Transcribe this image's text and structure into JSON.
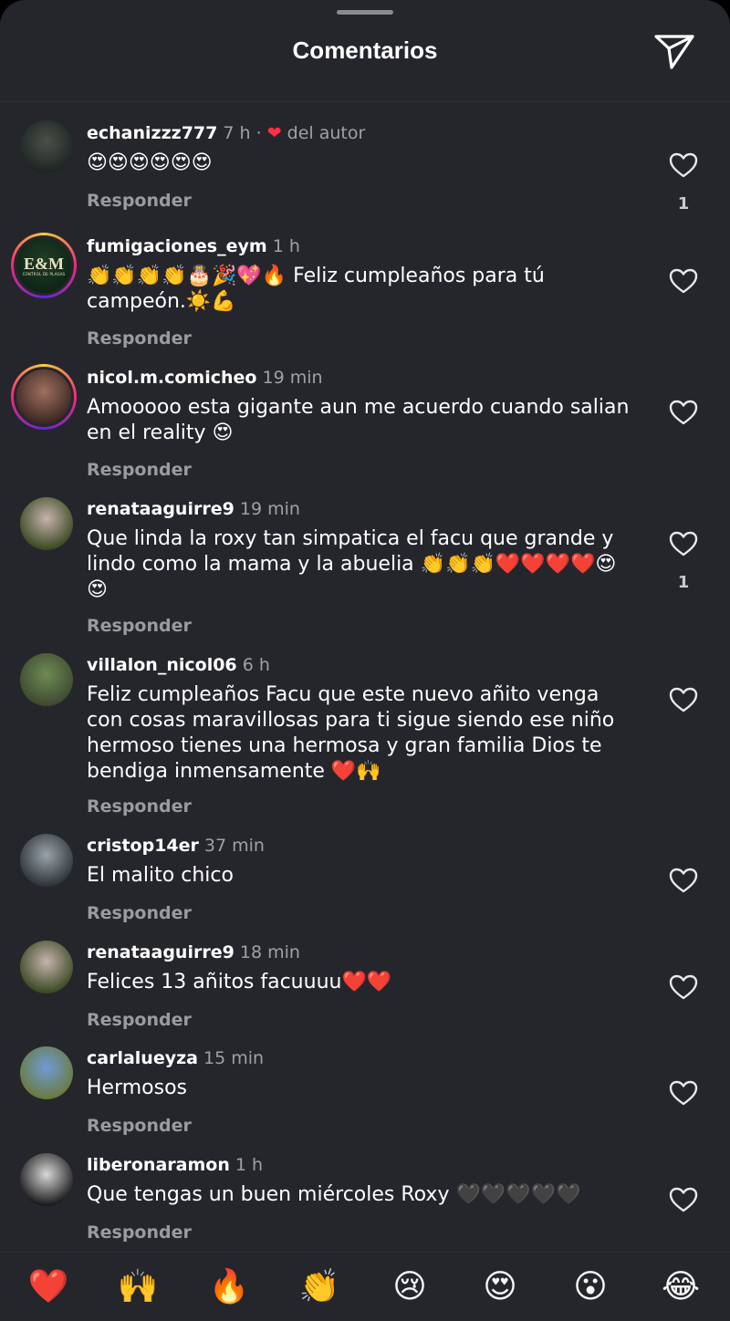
{
  "header": {
    "title": "Comentarios"
  },
  "comments": [
    {
      "user": "echanizzz777",
      "time": "7 h",
      "sep": "·",
      "heart_glyph": "❤",
      "by_author": "del autor",
      "text": "😍😍😍😍😍😍",
      "reply": "Responder",
      "likes": "1",
      "ring": false,
      "avatar_colors": [
        "#4a5148",
        "#1e2422"
      ]
    },
    {
      "user": "fumigaciones_eym",
      "time": "1 h",
      "text": "👏👏👏👏🎂🎉💖🔥 Feliz cumpleaños para tú campeón.☀️💪",
      "reply": "Responder",
      "ring": true,
      "avatar_logo": "E&M",
      "avatar_sub": "CONTROL DE PLAGAS",
      "avatar_colors": [
        "#1e3d26",
        "#0f2416"
      ]
    },
    {
      "user": "nicol.m.comicheo",
      "time": "19 min",
      "text": "Amooooo esta gigante aun me acuerdo cuando salian en el reality 😍",
      "reply": "Responder",
      "ring": true,
      "avatar_colors": [
        "#a07060",
        "#3b2722"
      ]
    },
    {
      "user": "renataaguirre9",
      "time": "19 min",
      "text": "Que linda la roxy tan simpatica el facu que grande y lindo como la mama y la abuelia 👏👏👏❤️❤️❤️❤️😍😍",
      "reply": "Responder",
      "likes": "1",
      "ring": false,
      "avatar_colors": [
        "#c7b2ae",
        "#3a4a22"
      ]
    },
    {
      "user": "villalon_nicol06",
      "time": "6 h",
      "text": "Feliz cumpleaños Facu que este nuevo añito venga con cosas maravillosas para ti sigue siendo ese niño hermoso tienes una hermosa y gran familia Dios te bendiga inmensamente ❤️🙌",
      "reply": "Responder",
      "ring": false,
      "avatar_colors": [
        "#6f8a55",
        "#3d4a30"
      ]
    },
    {
      "user": "cristop14er",
      "time": "37 min",
      "text": "El malito chico",
      "reply": "Responder",
      "ring": false,
      "avatar_colors": [
        "#9aa3aa",
        "#2e3438"
      ]
    },
    {
      "user": "renataaguirre9",
      "time": "18 min",
      "text": "Felices 13 añitos facuuuu❤️❤️",
      "reply": "Responder",
      "ring": false,
      "avatar_colors": [
        "#c7b2ae",
        "#3a4a22"
      ]
    },
    {
      "user": "carlalueyza",
      "time": "15 min",
      "text": "Hermosos",
      "reply": "Responder",
      "ring": false,
      "avatar_colors": [
        "#6f9cd6",
        "#6a7a3e"
      ]
    },
    {
      "user": "liberonaramon",
      "time": "1 h",
      "text": "Que tengas un buen miércoles Roxy 🖤🖤🖤🖤🖤",
      "reply": "Responder",
      "ring": false,
      "avatar_colors": [
        "#d8d8d8",
        "#1a1a1a"
      ]
    }
  ],
  "reactions": [
    "❤️",
    "🙌",
    "🔥",
    "👏",
    "😢",
    "😍",
    "😮",
    "😂"
  ],
  "colors": {
    "sheet": "#25262b",
    "author_heart": "#ff3040",
    "muted": "#a0a1a6"
  }
}
